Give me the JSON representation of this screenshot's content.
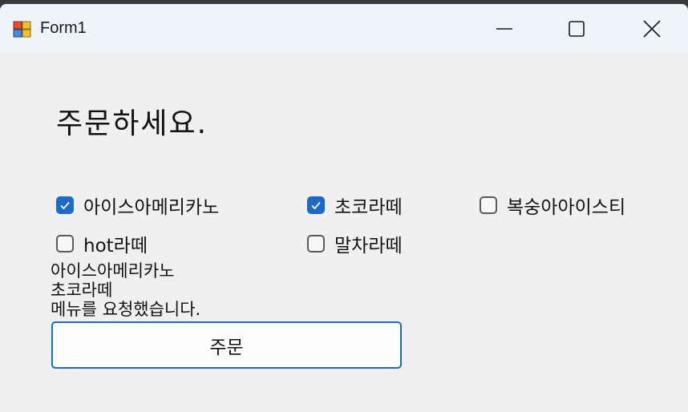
{
  "window": {
    "title": "Form1"
  },
  "form": {
    "heading": "주문하세요.",
    "checkboxes": [
      {
        "label": "아이스아메리카노",
        "checked": true
      },
      {
        "label": "초코라떼",
        "checked": true
      },
      {
        "label": "복숭아아이스티",
        "checked": false
      },
      {
        "label": "hot라떼",
        "checked": false
      },
      {
        "label": "말차라떼",
        "checked": false
      }
    ],
    "result_lines": [
      "아이스아메리카노",
      "초코라떼",
      "메뉴를 요청했습니다."
    ],
    "order_button_label": "주문"
  },
  "colors": {
    "accent": "#1a6ac6",
    "window_bg": "#f0f0f0",
    "titlebar_bg": "#eff4f9"
  },
  "icons": {
    "app": "winforms-app-icon",
    "minimize": "minimize-icon",
    "maximize": "maximize-icon",
    "close": "close-icon",
    "check": "checkmark-icon"
  }
}
